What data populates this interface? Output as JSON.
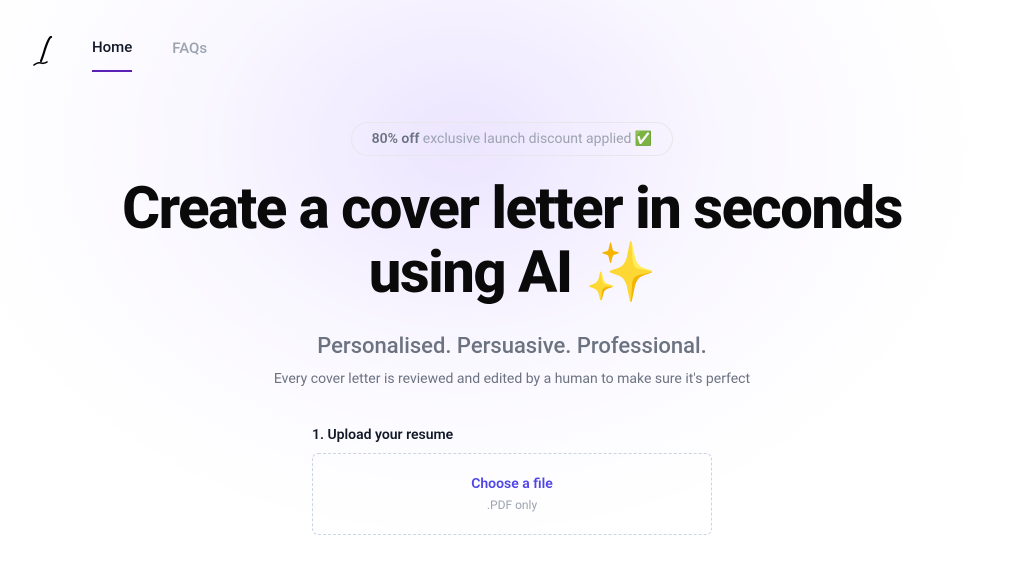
{
  "nav": {
    "items": [
      {
        "label": "Home"
      },
      {
        "label": "FAQs"
      }
    ]
  },
  "discount": {
    "bold": "80% off",
    "rest": " exclusive launch discount applied ✅"
  },
  "hero": {
    "headline": "Create a cover letter in seconds using AI ✨",
    "subheadline": "Personalised. Persuasive. Professional.",
    "description": "Every cover letter is reviewed and edited by a human to make sure it's perfect"
  },
  "upload": {
    "label": "1. Upload your resume",
    "cta": "Choose a file",
    "hint": ".PDF only"
  }
}
